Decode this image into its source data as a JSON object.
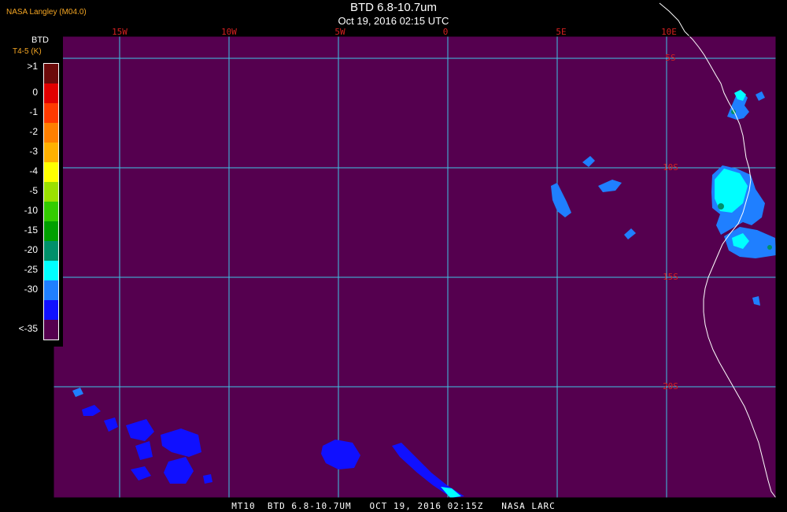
{
  "header": {
    "title": "BTD 6.8-10.7um",
    "subtitle": "Oct 19, 2016 02:15 UTC",
    "producer": "NASA Langley (M04.0)"
  },
  "legend": {
    "title": "BTD",
    "units": "T4-5 (K)",
    "entries": [
      {
        "label": ">1",
        "color": "#6b0a0a"
      },
      {
        "label": "0",
        "color": "#e10000"
      },
      {
        "label": "-1",
        "color": "#ff3a00"
      },
      {
        "label": "-2",
        "color": "#ff7f00"
      },
      {
        "label": "-3",
        "color": "#ffb000"
      },
      {
        "label": "-4",
        "color": "#ffff00"
      },
      {
        "label": "-5",
        "color": "#9be000"
      },
      {
        "label": "-10",
        "color": "#33cc00"
      },
      {
        "label": "-15",
        "color": "#00a000"
      },
      {
        "label": "-20",
        "color": "#00906a"
      },
      {
        "label": "-25",
        "color": "#00ffff"
      },
      {
        "label": "-30",
        "color": "#1f7fff"
      },
      {
        "label": "",
        "color": "#1010ff"
      },
      {
        "label": "<-35",
        "color": "#55004f"
      }
    ]
  },
  "grid": {
    "longitudes": [
      "15W",
      "10W",
      "5W",
      "0",
      "5E",
      "10E"
    ],
    "latitudes": [
      "5S",
      "10S",
      "15S",
      "20S"
    ],
    "color": "#3ec6e6"
  },
  "colors": {
    "background": "#55004f",
    "coast": "#ffffff",
    "cloud_cyan": "#00ffff",
    "cloud_blue": "#1f7fff",
    "cloud_deep": "#1010ff"
  },
  "footer": "MT10  BTD 6.8-10.7UM   OCT 19, 2016 02:15Z   NASA LARC"
}
